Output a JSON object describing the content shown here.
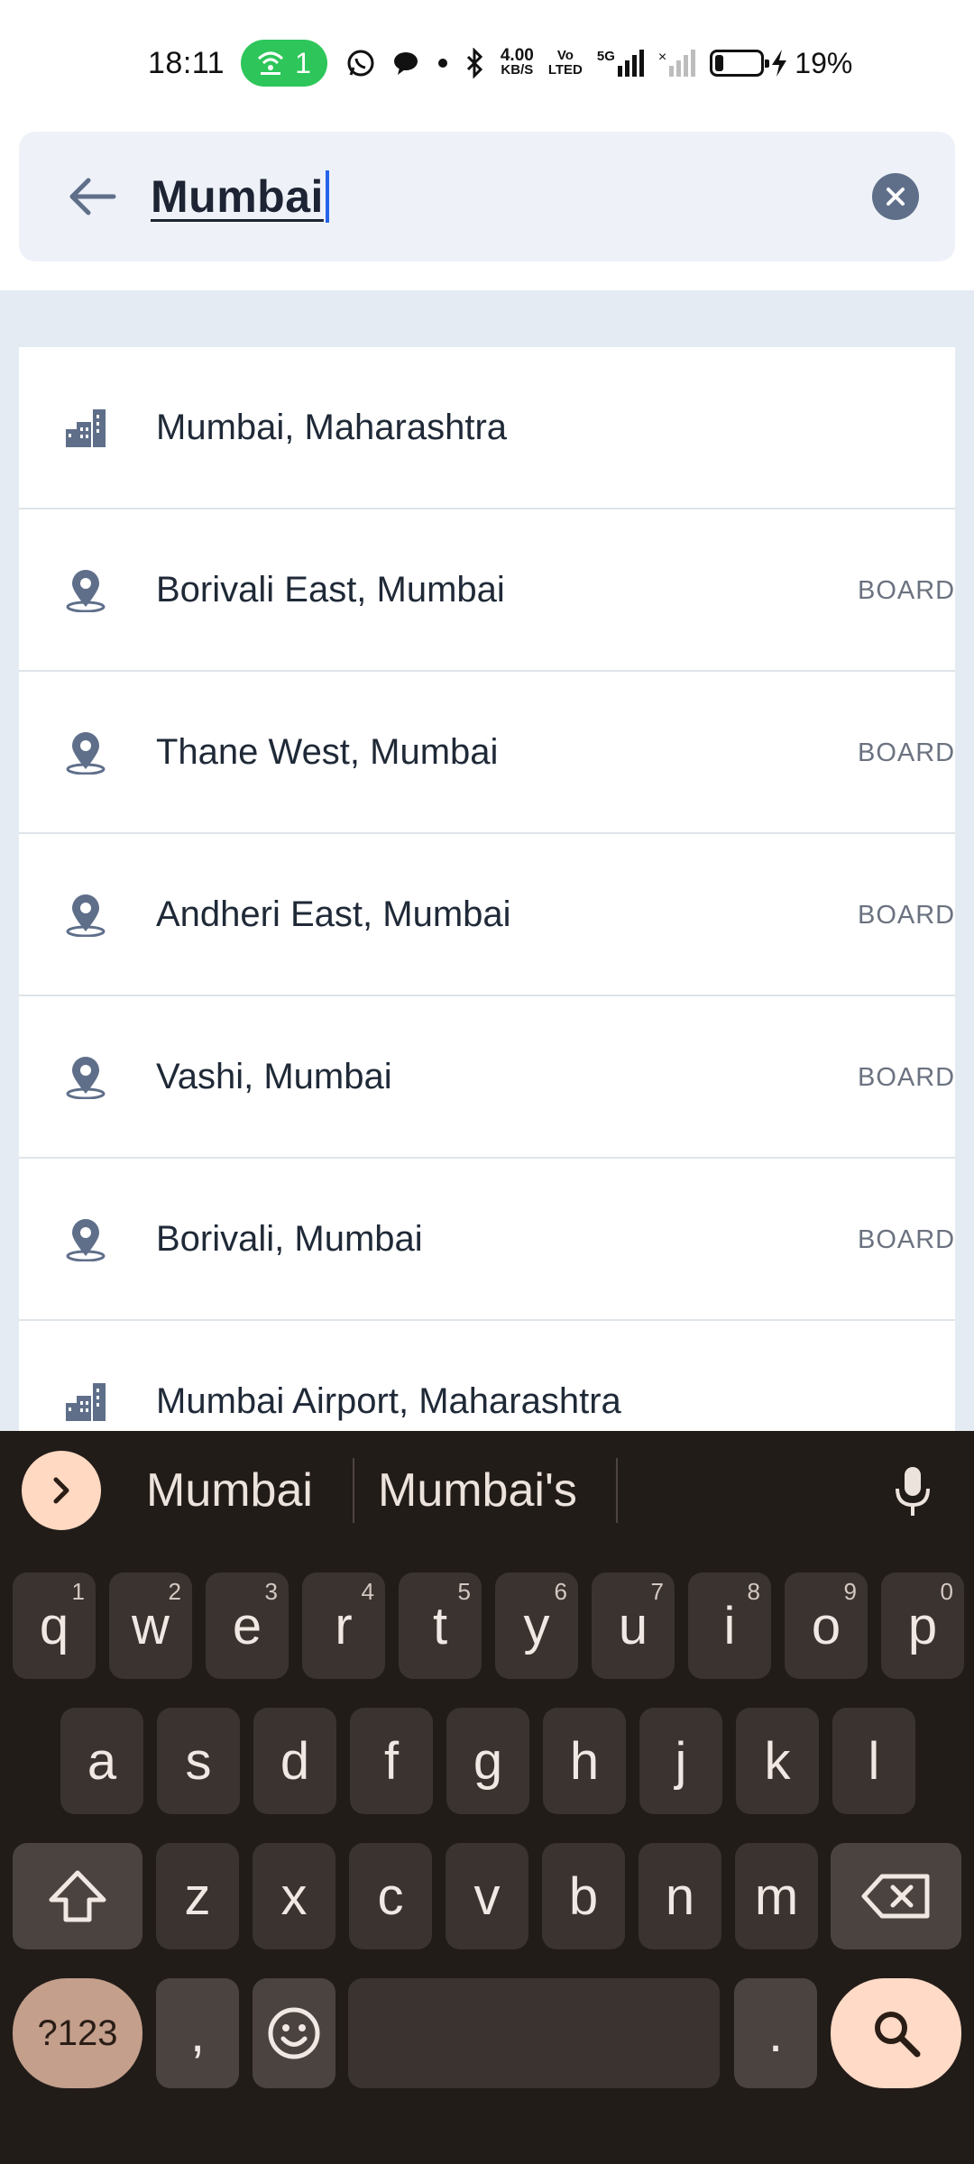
{
  "status_bar": {
    "time": "18:11",
    "hotspot_count": "1",
    "net_speed_top": "4.00",
    "net_speed_bottom": "KB/S",
    "volte_top": "Vo",
    "volte_bottom": "LTED",
    "network_type": "5G",
    "battery_percent": "19%",
    "battery_level": 0.19
  },
  "search": {
    "query": "Mumbai",
    "back_icon": "arrow-left-icon",
    "clear_icon": "close-circle-icon"
  },
  "results": [
    {
      "label": "Mumbai, Maharashtra",
      "icon": "city-icon",
      "tag": ""
    },
    {
      "label": "Borivali East, Mumbai",
      "icon": "location-pin-icon",
      "tag": "BOARD AT"
    },
    {
      "label": "Thane West, Mumbai",
      "icon": "location-pin-icon",
      "tag": "BOARD AT"
    },
    {
      "label": "Andheri East, Mumbai",
      "icon": "location-pin-icon",
      "tag": "BOARD AT"
    },
    {
      "label": "Vashi, Mumbai",
      "icon": "location-pin-icon",
      "tag": "BOARD AT"
    },
    {
      "label": "Borivali, Mumbai",
      "icon": "location-pin-icon",
      "tag": "BOARD AT"
    },
    {
      "label": "Mumbai Airport, Maharashtra",
      "icon": "city-icon",
      "tag": ""
    }
  ],
  "keyboard": {
    "suggestions": [
      "Mumbai",
      "Mumbai's"
    ],
    "row1": [
      {
        "key": "q",
        "hint": "1"
      },
      {
        "key": "w",
        "hint": "2"
      },
      {
        "key": "e",
        "hint": "3"
      },
      {
        "key": "r",
        "hint": "4"
      },
      {
        "key": "t",
        "hint": "5"
      },
      {
        "key": "y",
        "hint": "6"
      },
      {
        "key": "u",
        "hint": "7"
      },
      {
        "key": "i",
        "hint": "8"
      },
      {
        "key": "o",
        "hint": "9"
      },
      {
        "key": "p",
        "hint": "0"
      }
    ],
    "row2": [
      "a",
      "s",
      "d",
      "f",
      "g",
      "h",
      "j",
      "k",
      "l"
    ],
    "row3": [
      "z",
      "x",
      "c",
      "v",
      "b",
      "n",
      "m"
    ],
    "symbols_label": "?123",
    "comma": ",",
    "period": "."
  },
  "colors": {
    "accent_blue": "#2563eb",
    "search_bg": "#eef2f8",
    "keyboard_bg": "#221c19",
    "hotspot_green": "#2ec65a"
  }
}
